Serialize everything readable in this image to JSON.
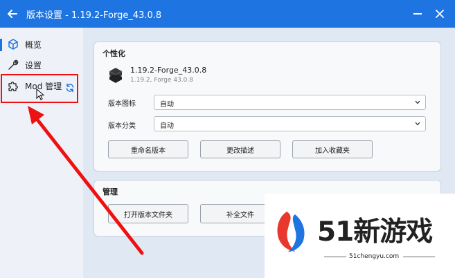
{
  "window": {
    "title": "版本设置 - 1.19.2-Forge_43.0.8",
    "accent": "#1e74e0"
  },
  "sidebar": {
    "items": [
      {
        "label": "概览",
        "icon": "cube-icon"
      },
      {
        "label": "设置",
        "icon": "wrench-icon"
      },
      {
        "label": "Mod 管理",
        "icon": "puzzle-icon"
      }
    ]
  },
  "personalize": {
    "heading": "个性化",
    "version_name": "1.19.2-Forge_43.0.8",
    "version_sub": "1.19.2, Forge 43.0.8",
    "icon_label": "版本图标",
    "icon_value": "自动",
    "category_label": "版本分类",
    "category_value": "自动",
    "buttons": [
      "重命名版本",
      "更改描述",
      "加入收藏夹"
    ]
  },
  "manage": {
    "heading": "管理",
    "buttons": [
      "打开版本文件夹",
      "补全文件"
    ]
  },
  "watermark": {
    "title": "51新游戏",
    "url": "51chengyu.com"
  },
  "annotation_color": "#e11"
}
